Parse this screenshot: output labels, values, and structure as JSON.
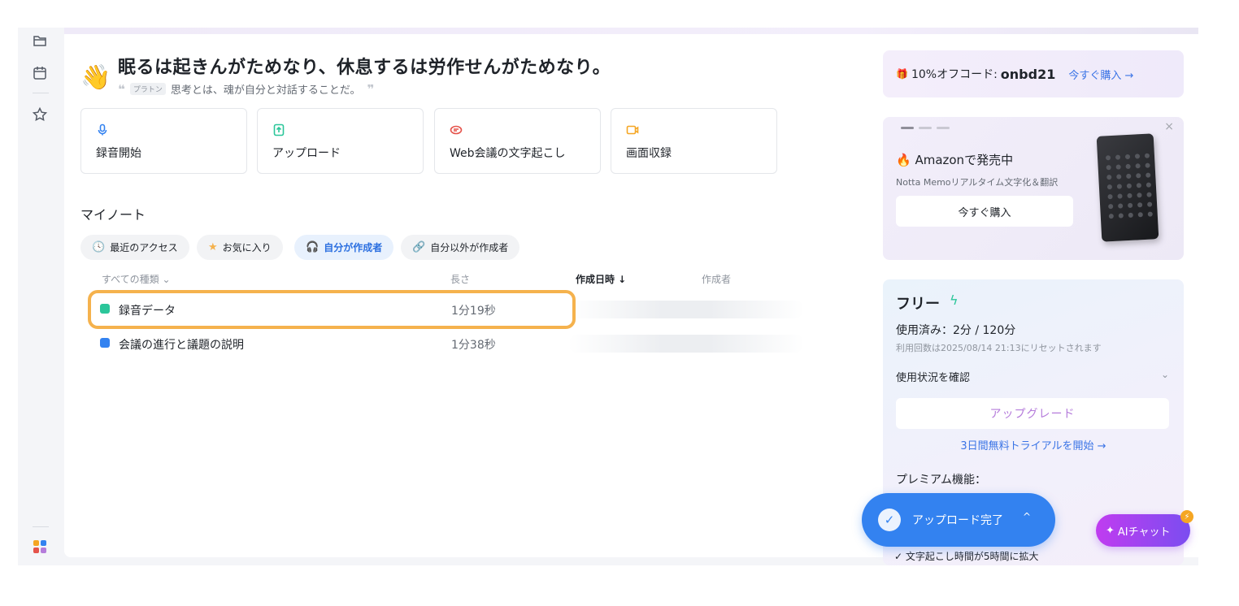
{
  "hero": {
    "title": "眠るは起きんがためなり、休息するは労作せんがためなり。",
    "quote_author": "プラトン",
    "quote_text": "思考とは、魂が自分と対話することだ。"
  },
  "actions": [
    {
      "label": "録音開始",
      "icon": "microphone-icon",
      "color": "#3382f0"
    },
    {
      "label": "アップロード",
      "icon": "upload-icon",
      "color": "#2bc69a"
    },
    {
      "label": "Web会議の文字起こし",
      "icon": "meeting-icon",
      "color": "#e5534b"
    },
    {
      "label": "画面収録",
      "icon": "screen-record-icon",
      "color": "#f5a623"
    }
  ],
  "notes": {
    "title": "マイノート",
    "filters": [
      {
        "label": "最近のアクセス",
        "icon": "clock-icon",
        "active": false
      },
      {
        "label": "お気に入り",
        "icon": "star-icon",
        "active": false
      },
      {
        "label": "自分が作成者",
        "icon": "headphones-icon",
        "active": true
      },
      {
        "label": "自分以外が作成者",
        "icon": "link-icon",
        "active": false
      }
    ],
    "columns": {
      "type": "すべての種類 ⌄",
      "length": "長さ",
      "created": "作成日時 ↓",
      "author": "作成者"
    },
    "rows": [
      {
        "name": "録音データ",
        "length": "1分19秒",
        "icon": "audio-file-icon",
        "icon_color": "#2bc69a"
      },
      {
        "name": "会議の進行と議題の説明",
        "length": "1分38秒",
        "icon": "microphone-icon",
        "icon_color": "#3382f0"
      }
    ]
  },
  "promo": {
    "prefix": "10%オフコード:",
    "code": "onbd21",
    "buy": "今すぐ購入 →"
  },
  "amazon": {
    "title": "🔥 Amazonで発売中",
    "subtitle": "Notta Memoリアルタイム文字化＆翻訳",
    "button": "今すぐ購入",
    "close": "×"
  },
  "plan": {
    "name": "フリー",
    "usage": "使用済み：2分 / 120分",
    "reset": "利用回数は2025/08/14 21:13にリセットされます",
    "check_usage": "使用状況を確認",
    "upgrade": "アップグレード",
    "trial": "3日間無料トライアルを開始 →",
    "premium": "プレミアム機能："
  },
  "toast": {
    "label": "アップロード完了",
    "chevron": "^"
  },
  "bottom_snippet": "✓ 文字起こし時間が5時間に拡大",
  "ai_chat": {
    "label": "AIチャット",
    "badge": "⚡"
  }
}
